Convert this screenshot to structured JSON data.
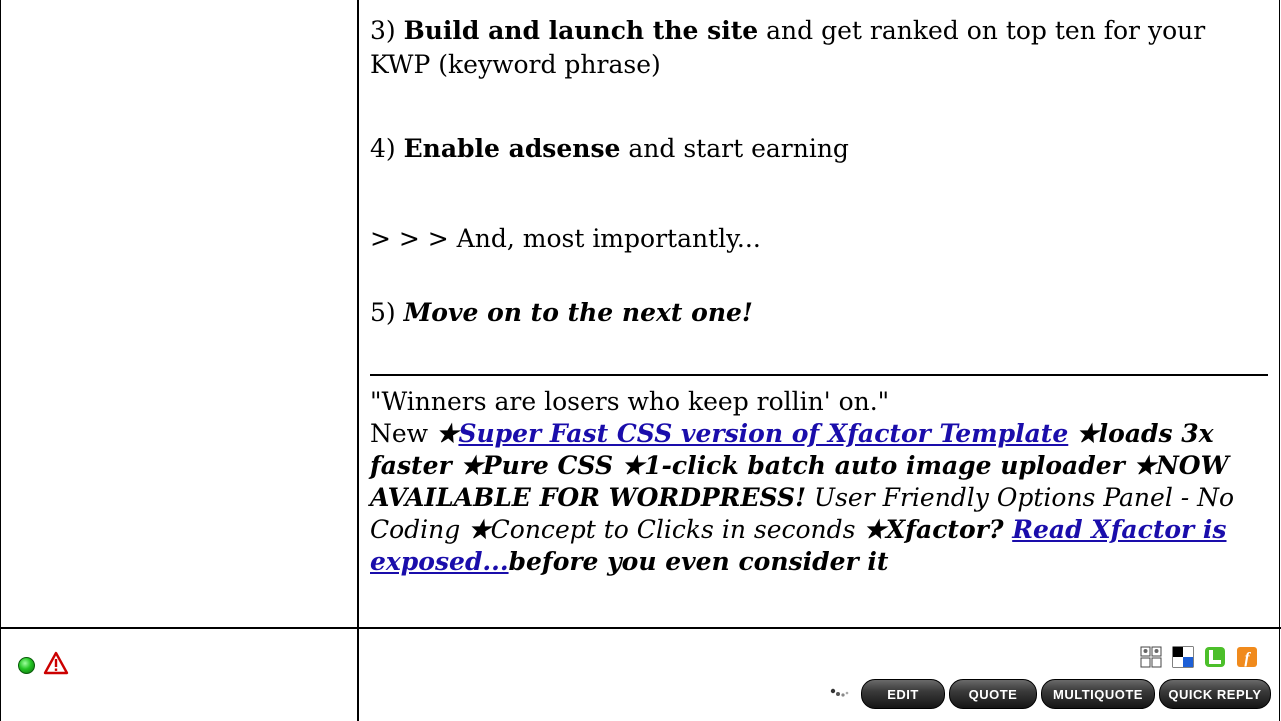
{
  "post": {
    "p3_num": "3) ",
    "p3_bold": "Build and launch the site",
    "p3_rest": " and get ranked on top ten for your KWP (keyword phrase)",
    "p4_num": "4) ",
    "p4_bold": "Enable adsense",
    "p4_rest": " and start earning",
    "p_mid": "> > > And, most importantly...",
    "p5_num": "5) ",
    "p5_bi": "Move on to the next one!"
  },
  "signature": {
    "quote": "\"Winners are losers who keep rollin' on.\"",
    "new_label": "New ",
    "star": "★",
    "link1": "Super Fast CSS version of Xfactor Template",
    "t1": "loads 3x faster ",
    "t2": "Pure CSS ",
    "t3": "1-click batch auto image uploader ",
    "t4": "NOW AVAILABLE FOR WORDPRESS!",
    "t5": " User Friendly Options Panel - No Coding ",
    "t6": "Concept to Clicks in seconds ",
    "t7": "Xfactor? ",
    "link2": "Read Xfactor is exposed...",
    "t8": "before you even consider it"
  },
  "footer": {
    "status_icon": "online-status-icon",
    "report_icon": "report-warning-icon",
    "share_icons": [
      "social-bookmark-icon",
      "delicious-icon",
      "technorati-icon",
      "facebook-icon"
    ],
    "buttons": {
      "edit": "EDIT",
      "quote": "QUOTE",
      "multiquote": "MULTIQUOTE",
      "quick_reply": "QUICK REPLY"
    }
  },
  "colors": {
    "link": "#1a0dab",
    "border": "#000000",
    "online": "#23c423",
    "warning": "#cc0000"
  }
}
